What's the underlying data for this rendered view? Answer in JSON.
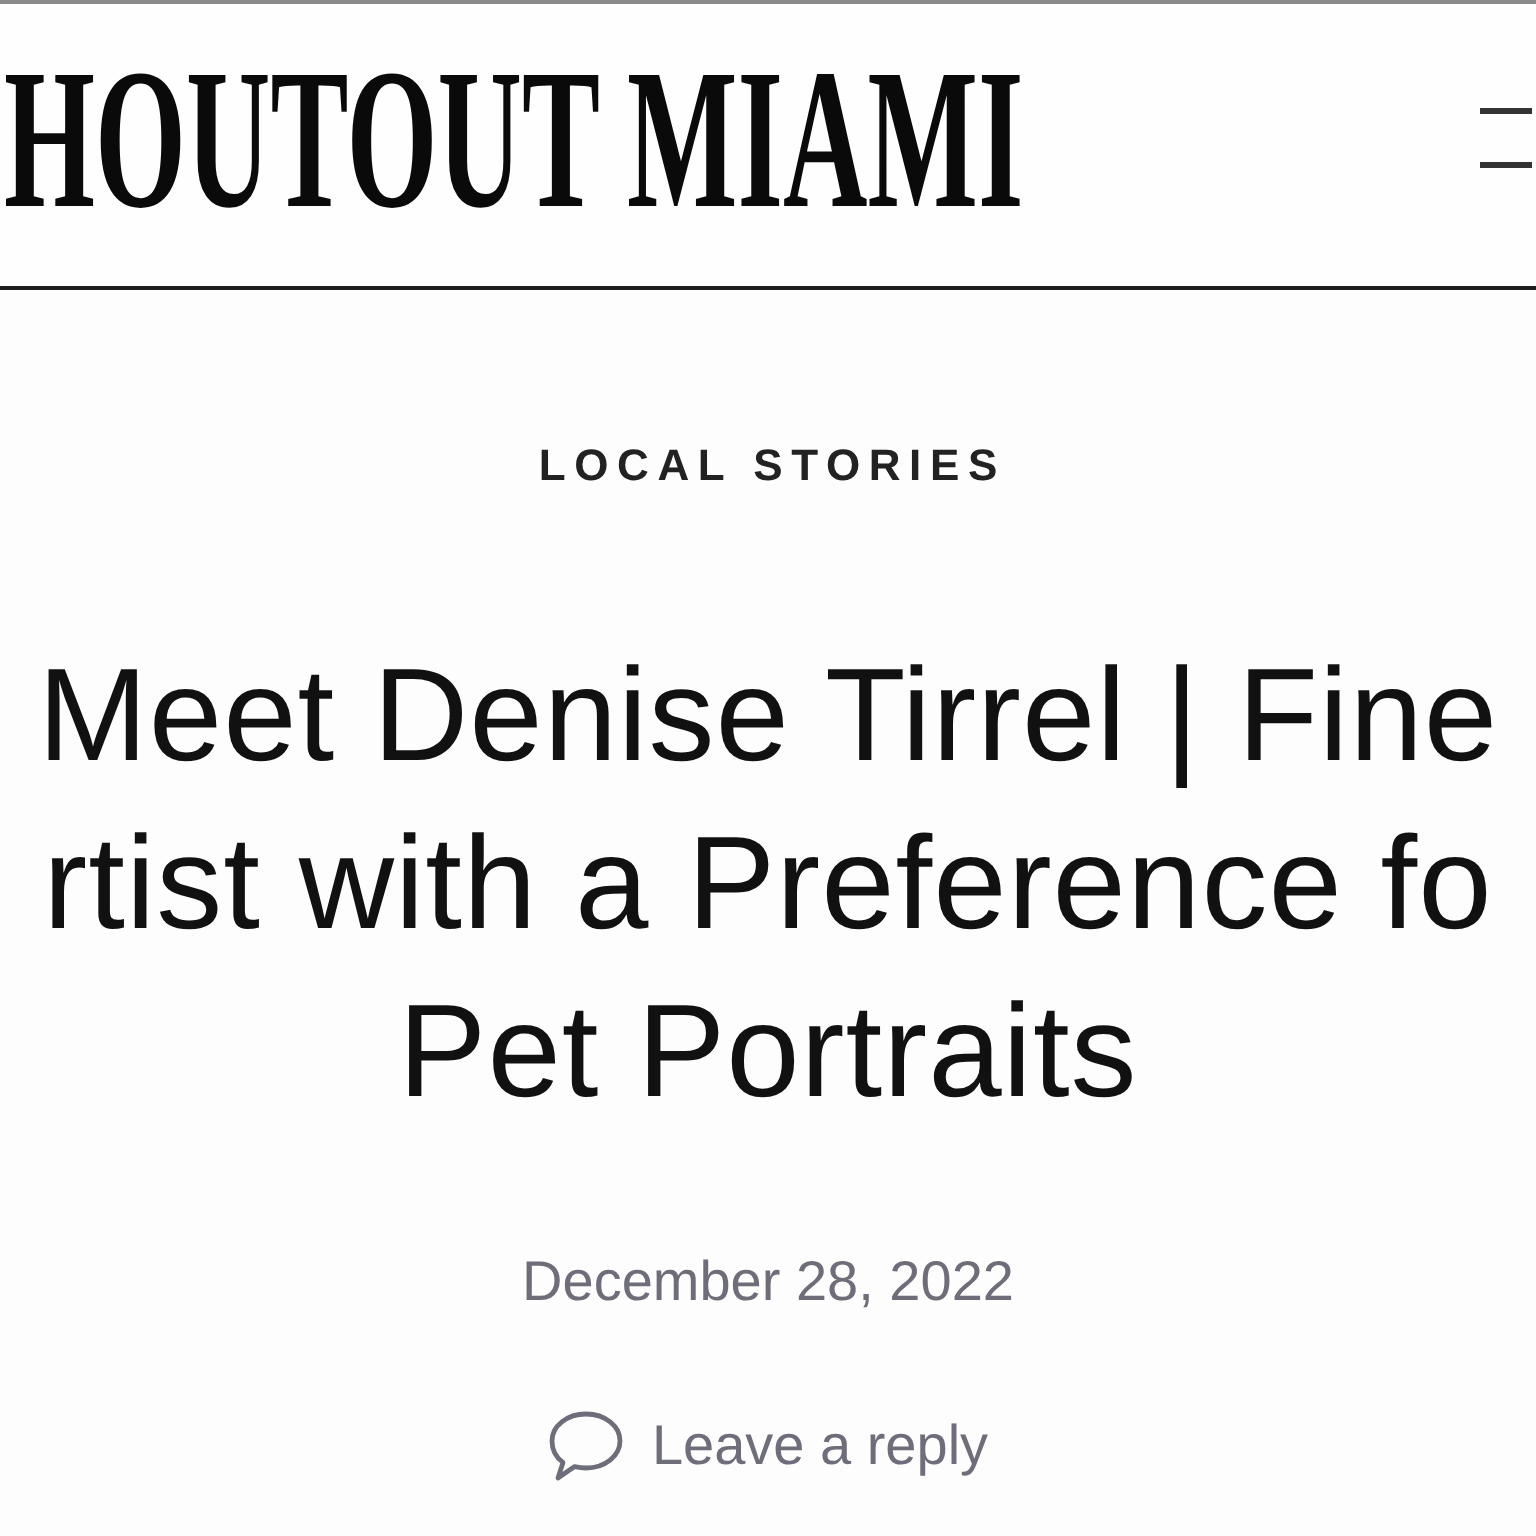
{
  "header": {
    "logo": "HOUTOUT MIAMI"
  },
  "article": {
    "category": "LOCAL STORIES",
    "title_lines": [
      "Meet Denise Tirrel | Fine",
      "rtist with a Preference fo",
      "Pet Portraits"
    ],
    "date": "December 28, 2022",
    "reply_link": "Leave a reply"
  }
}
